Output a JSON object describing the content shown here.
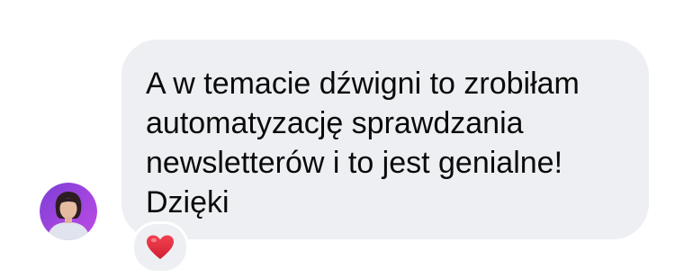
{
  "message": {
    "lines": [
      "A w temacie dźwigni to zrobiłam",
      "automatyzację sprawdzania",
      "newsletterów i to jest genialne!",
      "Dzięki"
    ]
  },
  "sender": {
    "avatar_icon": "user-avatar",
    "avatar_ring_color": "#b14be0"
  },
  "reaction": {
    "icon": "heart-icon",
    "color": "#e0263a"
  },
  "colors": {
    "bubble": "#eeeff3",
    "text": "#0a0a0a"
  }
}
